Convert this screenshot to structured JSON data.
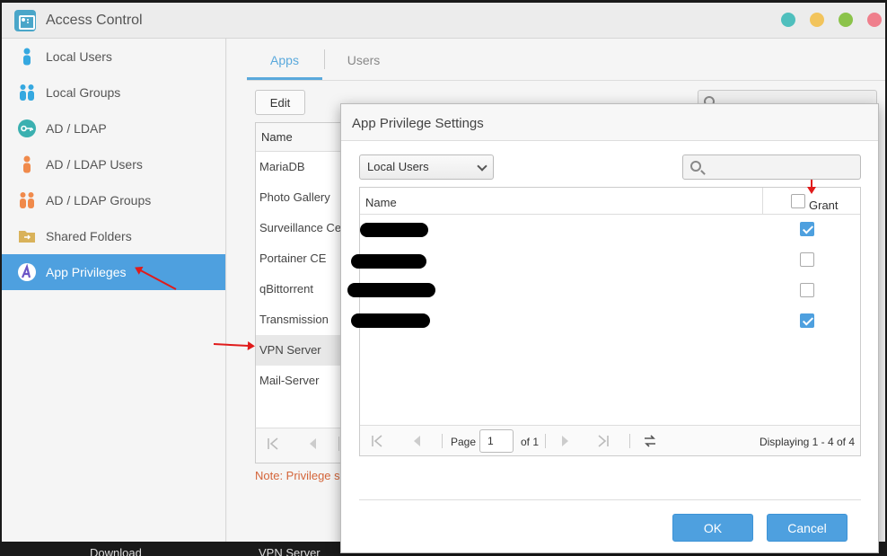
{
  "window": {
    "title": "Access Control"
  },
  "colors": {
    "accent": "#4ea0df",
    "dot_teal": "#4fbfbd",
    "dot_yellow": "#f2c45c",
    "dot_green": "#8bc34a",
    "dot_red": "#ef7f8c",
    "note": "#d4653a"
  },
  "sidebar": {
    "items": [
      {
        "label": "Local Users",
        "icon": "user-icon"
      },
      {
        "label": "Local Groups",
        "icon": "users-icon"
      },
      {
        "label": "AD / LDAP",
        "icon": "key-icon"
      },
      {
        "label": "AD / LDAP Users",
        "icon": "user-icon"
      },
      {
        "label": "AD / LDAP Groups",
        "icon": "users-icon"
      },
      {
        "label": "Shared Folders",
        "icon": "folder-icon"
      },
      {
        "label": "App Privileges",
        "icon": "app-privileges-icon",
        "active": true
      }
    ]
  },
  "main": {
    "tabs": [
      {
        "label": "Apps",
        "active": true
      },
      {
        "label": "Users"
      }
    ],
    "edit_label": "Edit",
    "list_header": "Name",
    "apps": [
      "MariaDB",
      "Photo Gallery",
      "Surveillance Ce...",
      "Portainer CE",
      "qBittorrent",
      "Transmission",
      "VPN Server",
      "Mail-Server"
    ],
    "selected_app": "VPN Server",
    "note": "Note: Privilege se"
  },
  "dialog": {
    "title": "App Privilege Settings",
    "filter": "Local Users",
    "col_name": "Name",
    "col_grant": "Grant",
    "rows": [
      {
        "granted": true
      },
      {
        "granted": false
      },
      {
        "granted": false
      },
      {
        "granted": true
      }
    ],
    "pager": {
      "page_label": "Page",
      "page_value": "1",
      "of_label": "of 1",
      "display": "Displaying 1 - 4 of 4"
    },
    "ok_label": "OK",
    "cancel_label": "Cancel"
  },
  "background_text": {
    "left": "Download",
    "right": "VPN Server"
  }
}
